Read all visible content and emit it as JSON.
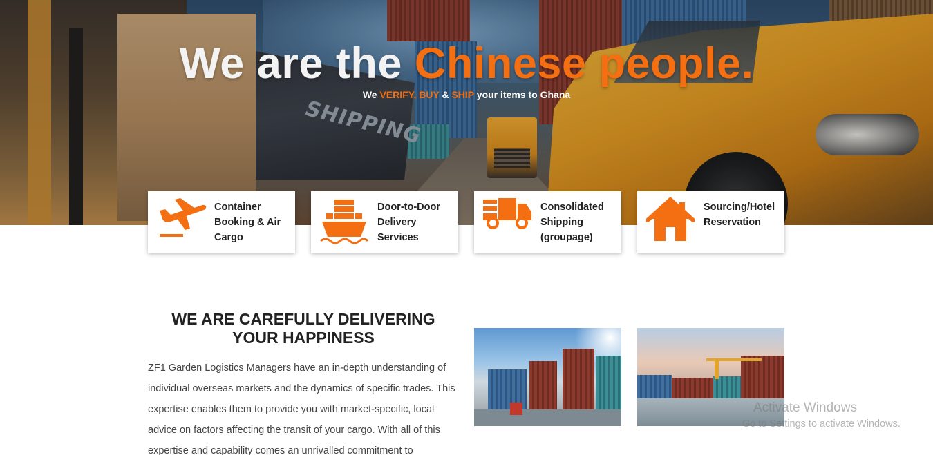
{
  "hero": {
    "title_main": "We are the ",
    "title_accent": "Chinese people.",
    "sub_we": "We ",
    "sub_verify_buy": "VERIFY, BUY",
    "sub_amp": " & ",
    "sub_ship": "SHIP",
    "sub_rest": " your items to Ghana",
    "ship_text": "SHIPPING"
  },
  "services": [
    {
      "label": "Container Booking & Air Cargo",
      "icon": "airplane-icon"
    },
    {
      "label": "Door-to-Door Delivery Services",
      "icon": "cargo-ship-icon"
    },
    {
      "label": "Consolidated Shipping (groupage)",
      "icon": "delivery-truck-icon"
    },
    {
      "label": "Sourcing/Hotel Reservation",
      "icon": "house-icon"
    }
  ],
  "about": {
    "title": "WE ARE CAREFULLY DELIVERING YOUR HAPPINESS",
    "text": "ZF1 Garden Logistics Managers have an in-depth understanding of individual overseas markets and the dynamics of specific trades. This expertise enables them to provide you with market-specific, local advice on factors affecting the transit of your cargo. With all of this expertise and capability comes an unrivalled commitment to"
  },
  "watermark": {
    "line1": "Activate Windows",
    "line2": "Go to Settings to activate Windows."
  },
  "colors": {
    "accent": "#f36f12",
    "card_text": "#222222",
    "body_text": "#444444"
  }
}
